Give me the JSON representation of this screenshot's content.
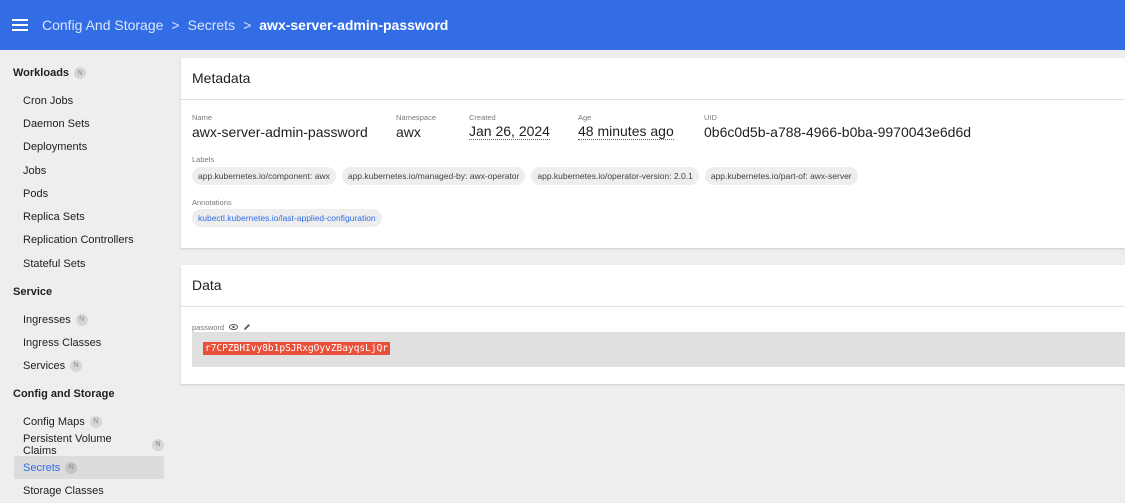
{
  "header": {
    "breadcrumbs": [
      "Config And Storage",
      "Secrets"
    ],
    "separator": ">",
    "current": "awx-server-admin-password"
  },
  "sidebar": {
    "workloads": {
      "title": "Workloads",
      "badge": "N",
      "items": [
        "Cron Jobs",
        "Daemon Sets",
        "Deployments",
        "Jobs",
        "Pods",
        "Replica Sets",
        "Replication Controllers",
        "Stateful Sets"
      ]
    },
    "service": {
      "title": "Service",
      "items": [
        {
          "label": "Ingresses",
          "badge": "N"
        },
        {
          "label": "Ingress Classes",
          "badge": ""
        },
        {
          "label": "Services",
          "badge": "N"
        }
      ]
    },
    "config": {
      "title": "Config and Storage",
      "items": [
        {
          "label": "Config Maps",
          "badge": "N"
        },
        {
          "label": "Persistent Volume Claims",
          "badge": "N"
        },
        {
          "label": "Secrets",
          "badge": "N"
        },
        {
          "label": "Storage Classes",
          "badge": ""
        }
      ]
    }
  },
  "metadata": {
    "title": "Metadata",
    "name_label": "Name",
    "name_value": "awx-server-admin-password",
    "namespace_label": "Namespace",
    "namespace_value": "awx",
    "created_label": "Created",
    "created_value": "Jan 26, 2024",
    "age_label": "Age",
    "age_value": "48 minutes ago",
    "uid_label": "UID",
    "uid_value": "0b6c0d5b-a788-4966-b0ba-9970043e6d6d",
    "labels_label": "Labels",
    "labels": [
      "app.kubernetes.io/component: awx",
      "app.kubernetes.io/managed-by: awx-operator",
      "app.kubernetes.io/operator-version: 2.0.1",
      "app.kubernetes.io/part-of: awx-server"
    ],
    "annotations_label": "Annotations",
    "annotations": [
      "kubectl.kubernetes.io/last-applied-configuration"
    ]
  },
  "data": {
    "title": "Data",
    "password_label": "password",
    "password_value": "r7CPZBHIvy8b1pSJRxgOyvZBayqsLjQr"
  },
  "colors": {
    "topbar": "#326de6",
    "active_link": "#326de6",
    "password_highlight": "#e8503a"
  }
}
